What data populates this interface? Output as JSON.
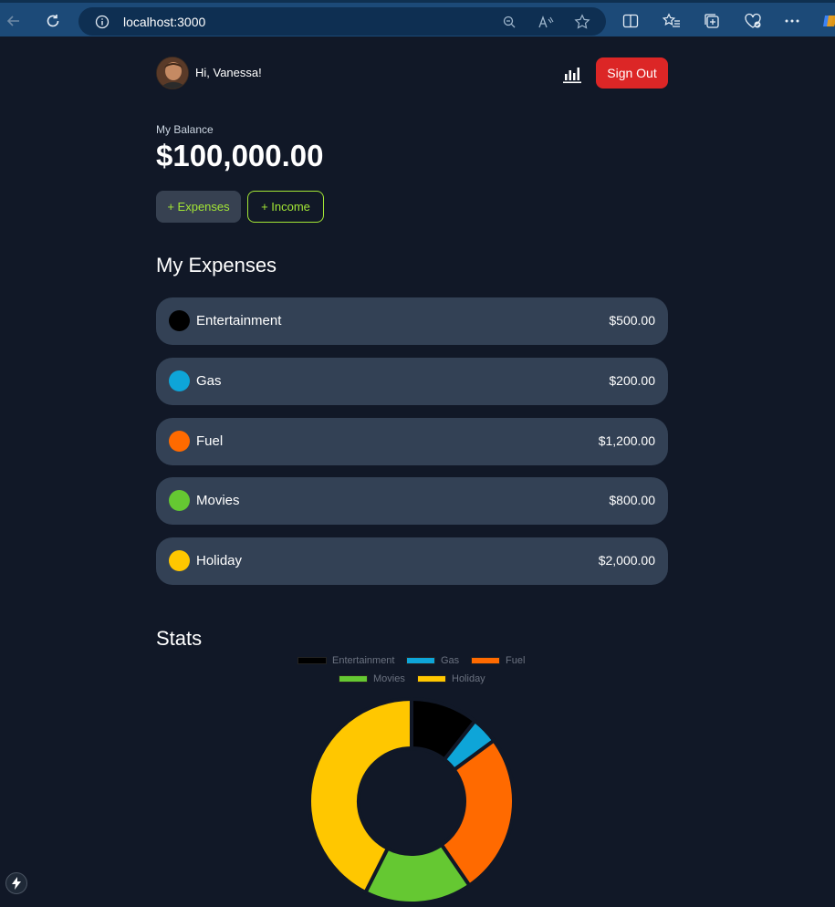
{
  "browser": {
    "url": "localhost:3000"
  },
  "header": {
    "greeting": "Hi, Vanessa!",
    "sign_out_label": "Sign Out"
  },
  "balance": {
    "label": "My Balance",
    "amount": "$100,000.00"
  },
  "actions": {
    "expenses_label": "+ Expenses",
    "income_label": "+ Income"
  },
  "expenses": {
    "title": "My Expenses",
    "items": [
      {
        "name": "Entertainment",
        "amount": "$500.00",
        "color": "#000000"
      },
      {
        "name": "Gas",
        "amount": "$200.00",
        "color": "#0ea5d8"
      },
      {
        "name": "Fuel",
        "amount": "$1,200.00",
        "color": "#ff6a00"
      },
      {
        "name": "Movies",
        "amount": "$800.00",
        "color": "#65c832"
      },
      {
        "name": "Holiday",
        "amount": "$2,000.00",
        "color": "#ffc700"
      }
    ]
  },
  "stats": {
    "title": "Stats"
  },
  "chart_data": {
    "type": "pie",
    "variant": "doughnut",
    "categories": [
      "Entertainment",
      "Gas",
      "Fuel",
      "Movies",
      "Holiday"
    ],
    "values": [
      500,
      200,
      1200,
      800,
      2000
    ],
    "colors": [
      "#000000",
      "#0ea5d8",
      "#ff6a00",
      "#65c832",
      "#ffc700"
    ],
    "legend": "top"
  }
}
